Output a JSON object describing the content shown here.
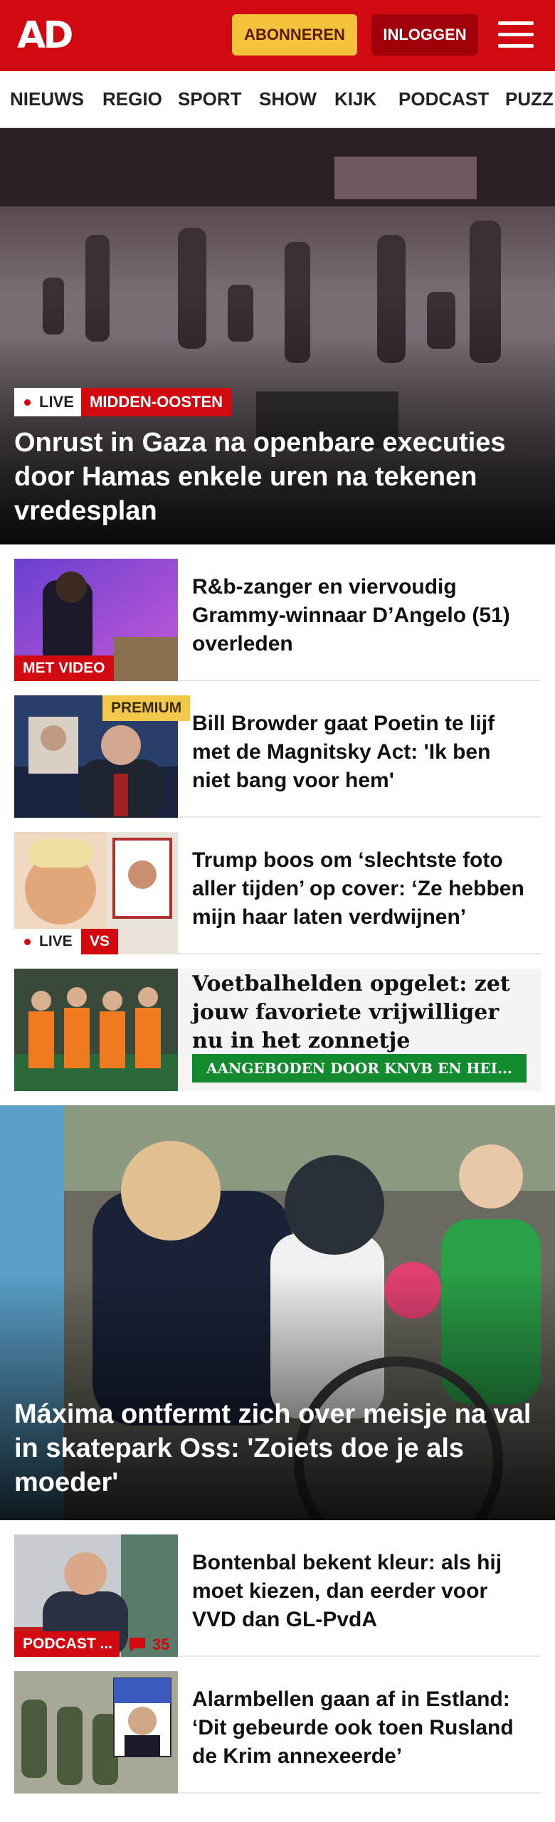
{
  "header": {
    "logo": "AD",
    "subscribe_label": "ABONNEREN",
    "login_label": "INLOGGEN"
  },
  "nav": {
    "items": [
      "NIEUWS",
      "REGIO",
      "SPORT",
      "SHOW",
      "KIJK",
      "PODCAST",
      "PUZZ"
    ]
  },
  "hero1": {
    "live_label": "LIVE",
    "category": "MIDDEN-OOSTEN",
    "title": "Onrust in Gaza na openbare executies door Hamas enkele uren na tekenen vredesplan"
  },
  "articles": [
    {
      "title": "R&b-zanger en viervoudig Grammy-winnaar D’Angelo (51) overleden",
      "badge": "MET VIDEO"
    },
    {
      "title": "Bill Browder gaat Poetin te lijf met de Magnitsky Act: 'Ik ben niet bang voor hem'",
      "badge": "PREMIUM"
    },
    {
      "title": "Trump boos om ‘slechtste foto aller tijden’ op cover: ‘Ze hebben mijn haar laten verdwijnen’",
      "live_label": "LIVE",
      "badge": "VS"
    },
    {
      "title": "Voetbalhelden opgelet: zet jouw favoriete vrijwilliger nu in het zonnetje",
      "sponsor": "AANGEBODEN DOOR KNVB EN HEI..."
    }
  ],
  "hero2": {
    "title": "Máxima ontfermt zich over meisje na val in skatepark Oss: 'Zoiets doe je als moeder'"
  },
  "articles2": [
    {
      "title": "Bontenbal bekent kleur: als hij moet kiezen, dan eerder voor VVD dan GL-PvdA",
      "badge": "PODCAST ...",
      "comments": "35"
    },
    {
      "title": "Alarmbellen gaan af in Estland: ‘Dit gebeurde ook toen Rusland de Krim annexeerde’"
    }
  ],
  "colors": {
    "brand_red": "#d10a11",
    "subscribe_yellow": "#f5c33b",
    "premium_yellow": "#f2c94c",
    "sponsor_green": "#138a2e"
  }
}
